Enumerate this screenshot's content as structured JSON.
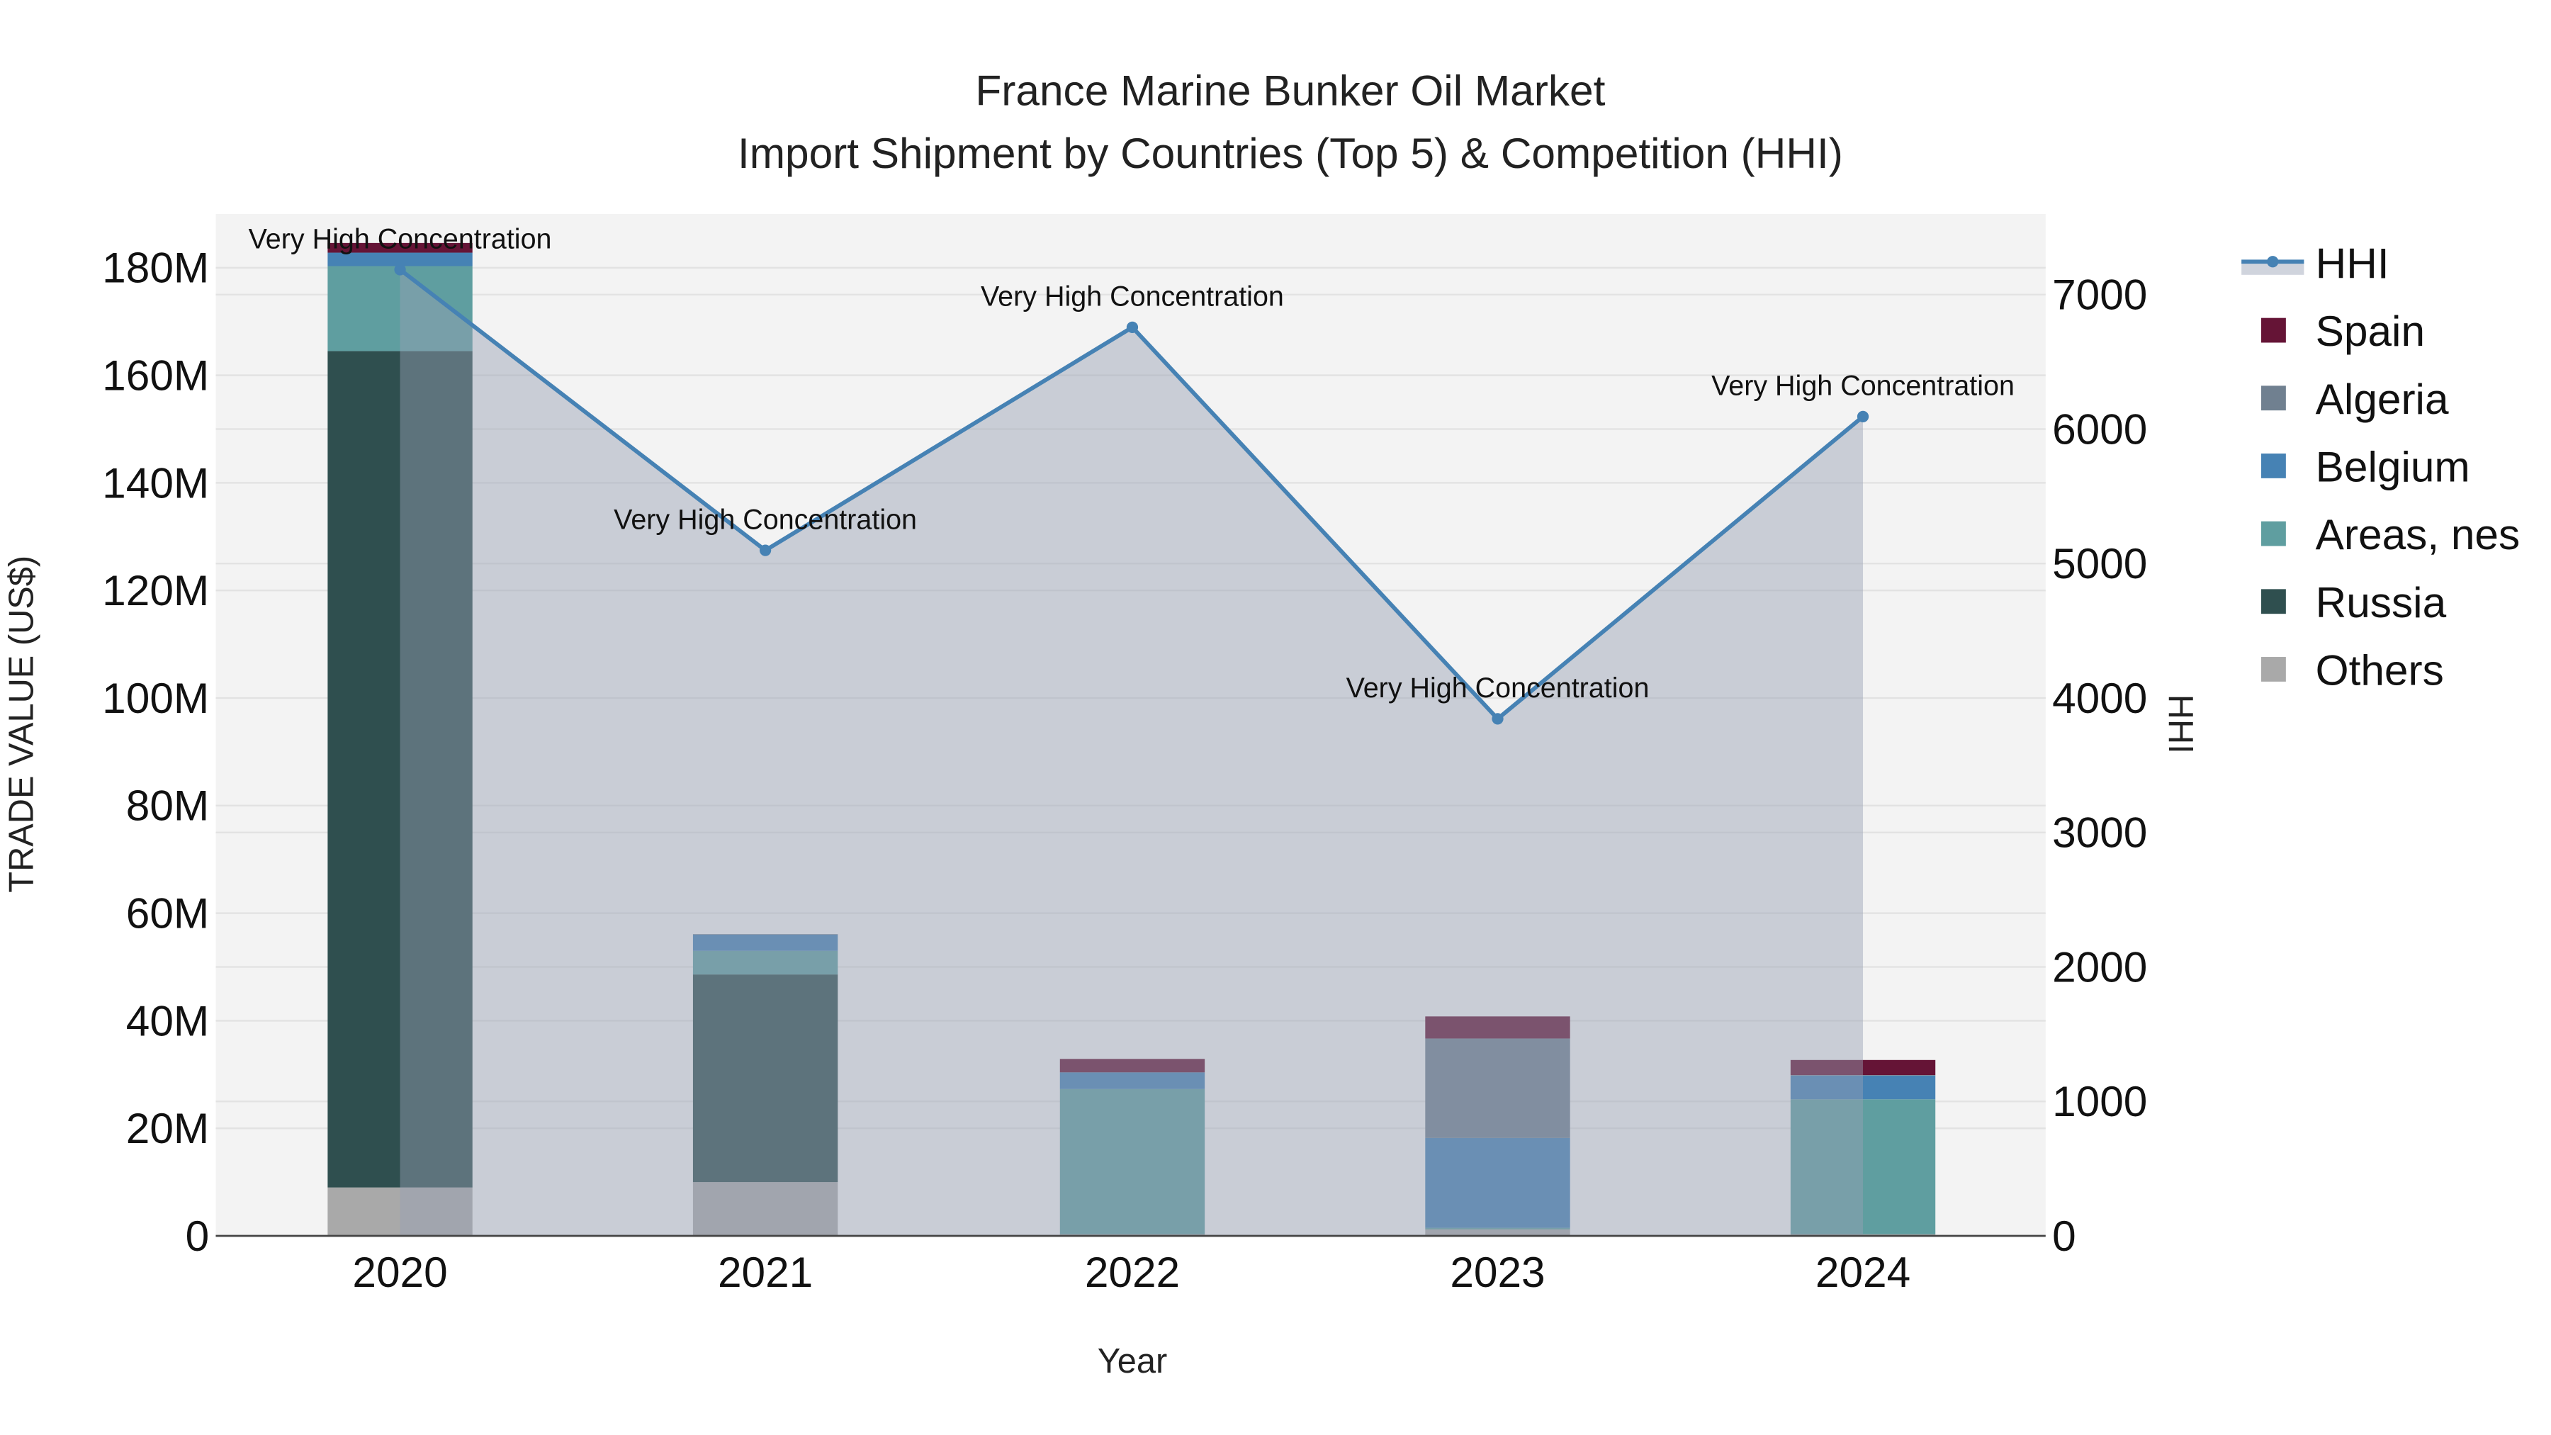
{
  "chart_data": {
    "type": "bar",
    "title": "France Marine Bunker Oil Market",
    "subtitle": "Import Shipment by Countries (Top 5) & Competition (HHI)",
    "xlabel": "Year",
    "ylabel": "TRADE VALUE (US$)",
    "y2label": "HHI",
    "categories": [
      "2020",
      "2021",
      "2022",
      "2023",
      "2024"
    ],
    "ylim": [
      0,
      190
    ],
    "y_ticks": [
      0,
      20,
      40,
      60,
      80,
      100,
      120,
      140,
      160,
      180
    ],
    "y_tick_labels": [
      "0",
      "20M",
      "40M",
      "60M",
      "80M",
      "100M",
      "120M",
      "140M",
      "160M",
      "180M"
    ],
    "y2lim": [
      0,
      7600
    ],
    "y2_ticks": [
      0,
      1000,
      2000,
      3000,
      4000,
      5000,
      6000,
      7000
    ],
    "y2_tick_labels": [
      "0",
      "1000",
      "2000",
      "3000",
      "4000",
      "5000",
      "6000",
      "7000"
    ],
    "units": "US$ millions",
    "series": [
      {
        "name": "Others",
        "color": "#a9a9a9",
        "values": [
          9.0,
          10.0,
          0.3,
          1.2,
          0.3
        ]
      },
      {
        "name": "Russia",
        "color": "#2f4f4f",
        "values": [
          155.5,
          38.6,
          0,
          0,
          0
        ]
      },
      {
        "name": "Areas, nes",
        "color": "#5f9ea0",
        "values": [
          15.8,
          4.4,
          27.0,
          0.3,
          25.1
        ]
      },
      {
        "name": "Belgium",
        "color": "#4682b4",
        "values": [
          2.5,
          3.0,
          3.1,
          16.7,
          4.4
        ]
      },
      {
        "name": "Algeria",
        "color": "#708090",
        "values": [
          0,
          0.1,
          0,
          18.5,
          0.1
        ]
      },
      {
        "name": "Spain",
        "color": "#651436",
        "values": [
          1.8,
          0,
          2.5,
          4.1,
          2.8
        ]
      }
    ],
    "hhi": {
      "name": "HHI",
      "color": "#4682b4",
      "values": [
        7186,
        5098,
        6757,
        3845,
        6093
      ],
      "annotations": [
        "Very High Concentration",
        "Very High Concentration",
        "Very High Concentration",
        "Very High Concentration",
        "Very High Concentration"
      ]
    },
    "legend_order": [
      "HHI",
      "Spain",
      "Algeria",
      "Belgium",
      "Areas, nes",
      "Russia",
      "Others"
    ],
    "legend_position": "right",
    "grid": true
  }
}
